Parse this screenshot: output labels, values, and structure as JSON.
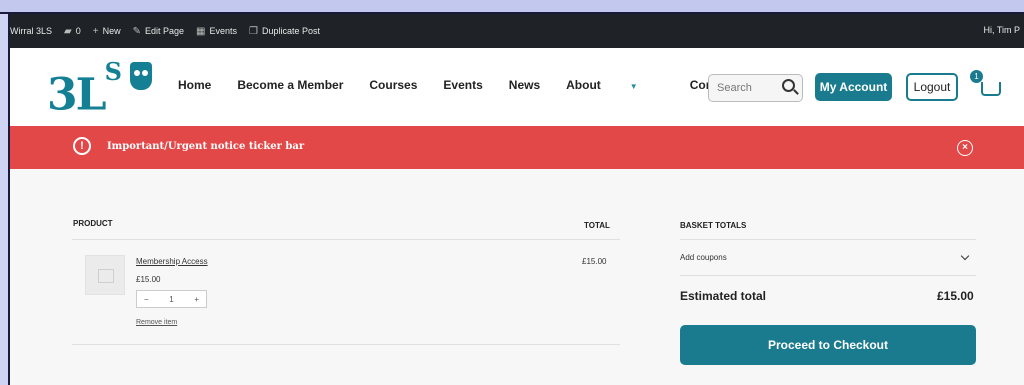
{
  "admin_bar": {
    "site_name": "Wirral 3LS",
    "comments_count": "0",
    "new_label": "New",
    "edit_page_label": "Edit Page",
    "events_label": "Events",
    "duplicate_label": "Duplicate Post",
    "greeting": "Hi, Tim P"
  },
  "header": {
    "logo_text": "3L",
    "logo_sup": "S",
    "nav": [
      "Home",
      "Become a Member",
      "Courses",
      "Events",
      "News",
      "About",
      "Contact"
    ],
    "search_placeholder": "Search",
    "my_account_label": "My Account",
    "logout_label": "Logout",
    "cart_count": "1"
  },
  "notice": {
    "text": "Important/Urgent notice ticker bar",
    "warn_symbol": "!",
    "close_symbol": "×"
  },
  "cart": {
    "product_header": "PRODUCT",
    "total_header": "TOTAL",
    "item": {
      "name": "Membership Access",
      "price": "£15.00",
      "quantity": "1",
      "minus": "−",
      "plus": "+",
      "remove_label": "Remove item",
      "line_total": "£15.00"
    }
  },
  "totals": {
    "header": "BASKET TOTALS",
    "coupons_label": "Add coupons",
    "estimated_label": "Estimated total",
    "estimated_value": "£15.00",
    "checkout_label": "Proceed to Checkout"
  },
  "colors": {
    "brand": "#1a7b8f",
    "notice_bg": "#e34848",
    "admin_bg": "#1f2327"
  }
}
